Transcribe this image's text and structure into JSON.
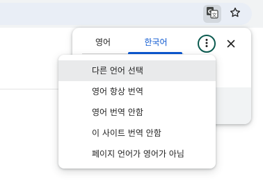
{
  "toolbar": {
    "translate_icon": "translate-page-icon",
    "star_icon": "bookmark-star-icon"
  },
  "translate_bubble": {
    "source_tab": "영어",
    "target_tab": "한국어",
    "selected_tab": "한국어",
    "accent_color": "#0b57d0",
    "more_icon": "more-vert-icon",
    "close_icon": "close-icon"
  },
  "options_menu": {
    "items": [
      {
        "label": "다른 언어 선택",
        "highlighted": true
      },
      {
        "label": "영어 항상 번역"
      },
      {
        "label": "영어 번역 안함"
      },
      {
        "label": "이 사이트 번역 안함"
      },
      {
        "label": "페이지 언어가 영어가 아님"
      }
    ]
  }
}
